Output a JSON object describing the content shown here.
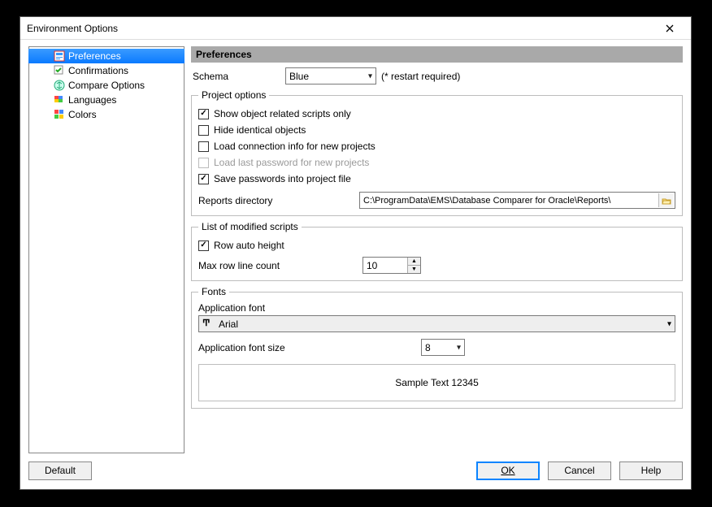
{
  "window": {
    "title": "Environment Options"
  },
  "sidebar": {
    "items": [
      {
        "label": "Preferences"
      },
      {
        "label": "Confirmations"
      },
      {
        "label": "Compare Options"
      },
      {
        "label": "Languages"
      },
      {
        "label": "Colors"
      }
    ]
  },
  "panel": {
    "header": "Preferences",
    "schema": {
      "label": "Schema",
      "value": "Blue",
      "hint": "(* restart required)"
    },
    "project_options": {
      "legend": "Project options",
      "items": [
        {
          "label": "Show object related scripts only",
          "checked": true
        },
        {
          "label": "Hide identical objects",
          "checked": false
        },
        {
          "label": "Load connection info for new projects",
          "checked": false
        },
        {
          "label": "Load last password for new projects",
          "checked": false,
          "disabled": true
        },
        {
          "label": "Save passwords into project file",
          "checked": true
        }
      ],
      "reports_dir": {
        "label": "Reports directory",
        "value": "C:\\ProgramData\\EMS\\Database Comparer for Oracle\\Reports\\"
      }
    },
    "modified_scripts": {
      "legend": "List of modified scripts",
      "row_auto_height": {
        "label": "Row auto height",
        "checked": true
      },
      "max_row_line_count": {
        "label": "Max row line count",
        "value": "10"
      }
    },
    "fonts": {
      "legend": "Fonts",
      "app_font": {
        "label": "Application font",
        "value": "Arial"
      },
      "app_font_size": {
        "label": "Application font size",
        "value": "8"
      },
      "sample": "Sample Text 12345"
    }
  },
  "footer": {
    "default": "Default",
    "ok": "OK",
    "cancel": "Cancel",
    "help": "Help"
  }
}
